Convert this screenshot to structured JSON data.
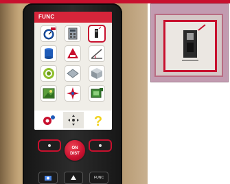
{
  "screen": {
    "title": "FUNC",
    "badge": "ON",
    "help_label": "?"
  },
  "keypad": {
    "on_label_top": "ON",
    "on_label_bottom": "DIST",
    "func_label": "FUNC"
  },
  "icons": [
    "stopwatch-icon",
    "grid-calc-icon",
    "laser-meter-icon",
    "cylinder-icon",
    "triangle-area-icon",
    "angle-slope-icon",
    "target-circle-icon",
    "plane-diamond-icon",
    "cube-volume-icon",
    "picture-icon",
    "crosshair-star-icon",
    "picture-add-icon",
    "settings-gear-icon",
    "nav-pad-icon",
    "help-icon"
  ],
  "colors": {
    "accent": "#c8102e",
    "screen_bg": "#f0eee8",
    "device_body": "#1d1d1d"
  }
}
